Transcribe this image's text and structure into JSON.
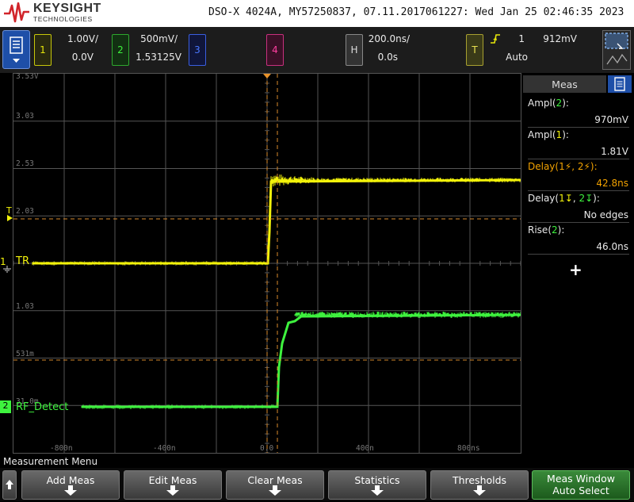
{
  "header": {
    "brand": "KEYSIGHT",
    "brand_sub": "TECHNOLOGIES",
    "title": "DSO-X 4024A, MY57250837, 07.11.2017061227: Wed Jan 25 02:46:35 2023"
  },
  "channels": [
    {
      "number": "1",
      "scale": "1.00V/",
      "offset": "0.0V",
      "color": "#f2f20a"
    },
    {
      "number": "2",
      "scale": "500mV/",
      "offset": "1.53125V",
      "color": "#3ef23e"
    },
    {
      "number": "3",
      "color": "#4a78ff"
    },
    {
      "number": "4",
      "color": "#ff3fa0"
    }
  ],
  "horizontal": {
    "key": "H",
    "scale": "200.0ns/",
    "delay": "0.0s"
  },
  "trigger": {
    "key": "T",
    "edge_icon": "rising-edge-icon",
    "source": "1",
    "level": "912mV",
    "mode": "Auto"
  },
  "screen": {
    "y_labels": [
      "3.53V",
      "3.03",
      "2.53",
      "2.03",
      "1.03",
      "531m",
      "31.0m"
    ],
    "x_labels": [
      "-800n",
      "-400n",
      "0.0",
      "400n",
      "800ns"
    ],
    "ch1_marker": "1",
    "ch1_name": "TR",
    "ch2_marker": "2",
    "ch2_name": "RF_Detect",
    "trigger_marker": "T"
  },
  "meas_panel": {
    "title": "Meas",
    "add_symbol": "+",
    "items": [
      {
        "name": "Ampl",
        "source": "2",
        "value": "970mV"
      },
      {
        "name": "Ampl",
        "source": "1",
        "value": "1.81V"
      },
      {
        "name": "Delay",
        "source_a": "1",
        "source_b": "2",
        "value": "42.8ns",
        "highlight_color": "#f2a200"
      },
      {
        "name": "Delay",
        "source_a": "1",
        "source_b": "2",
        "value": "No edges"
      },
      {
        "name": "Rise",
        "source": "2",
        "value": "46.0ns"
      }
    ]
  },
  "menu": {
    "title": "Measurement Menu",
    "softkeys": [
      "Add Meas",
      "Edit Meas",
      "Clear Meas",
      "Statistics",
      "Thresholds"
    ],
    "last_key_line1": "Meas Window",
    "last_key_line2": "Auto Select"
  },
  "colors": {
    "ch1": "#f2f20a",
    "ch2": "#3ef23e",
    "cursor": "#d98a2b",
    "grid": "#555555"
  }
}
